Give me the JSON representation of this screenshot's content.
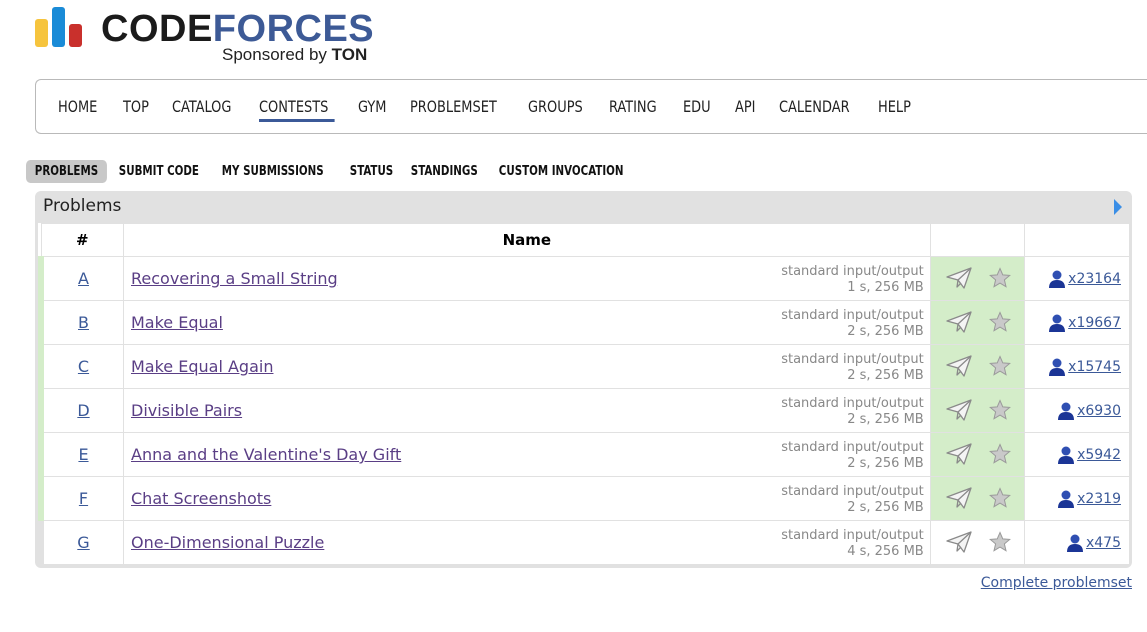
{
  "logo": {
    "text_dark": "CODE",
    "text_blue": "FORCES",
    "sponsor_prefix": "Sponsored by ",
    "sponsor_name": "TON"
  },
  "main_nav": [
    "HOME",
    "TOP",
    "CATALOG",
    "CONTESTS",
    "GYM",
    "PROBLEMSET",
    "GROUPS",
    "RATING",
    "EDU",
    "API",
    "CALENDAR",
    "HELP"
  ],
  "main_nav_active": "CONTESTS",
  "sub_nav": [
    "PROBLEMS",
    "SUBMIT CODE",
    "MY SUBMISSIONS",
    "STATUS",
    "STANDINGS",
    "CUSTOM INVOCATION"
  ],
  "sub_nav_active": "PROBLEMS",
  "panel": {
    "title": "Problems",
    "col_index": "#",
    "col_name": "Name"
  },
  "problems": [
    {
      "index": "A",
      "name": "Recovering a Small String",
      "io": "standard input/output",
      "limits": "1 s, 256 MB",
      "solved_count": "x23164"
    },
    {
      "index": "B",
      "name": "Make Equal",
      "io": "standard input/output",
      "limits": "2 s, 256 MB",
      "solved_count": "x19667"
    },
    {
      "index": "C",
      "name": "Make Equal Again",
      "io": "standard input/output",
      "limits": "2 s, 256 MB",
      "solved_count": "x15745"
    },
    {
      "index": "D",
      "name": "Divisible Pairs",
      "io": "standard input/output",
      "limits": "2 s, 256 MB",
      "solved_count": "x6930"
    },
    {
      "index": "E",
      "name": "Anna and the Valentine's Day Gift",
      "io": "standard input/output",
      "limits": "2 s, 256 MB",
      "solved_count": "x5942"
    },
    {
      "index": "F",
      "name": "Chat Screenshots",
      "io": "standard input/output",
      "limits": "2 s, 256 MB",
      "solved_count": "x2319"
    },
    {
      "index": "G",
      "name": "One-Dimensional Puzzle",
      "io": "standard input/output",
      "limits": "4 s, 256 MB",
      "solved_count": "x475"
    }
  ],
  "solved_rows": [
    "A",
    "B",
    "C",
    "D",
    "E",
    "F"
  ],
  "complete_link": "Complete problemset",
  "colors": {
    "accent": "#3b5998",
    "solved_bg": "#d4edc9",
    "problem_link": "#5a3e85"
  },
  "icons": {
    "submit": "paper-plane-icon",
    "favorite": "star-icon",
    "solvers": "user-icon",
    "expand": "triangle-right-icon"
  }
}
